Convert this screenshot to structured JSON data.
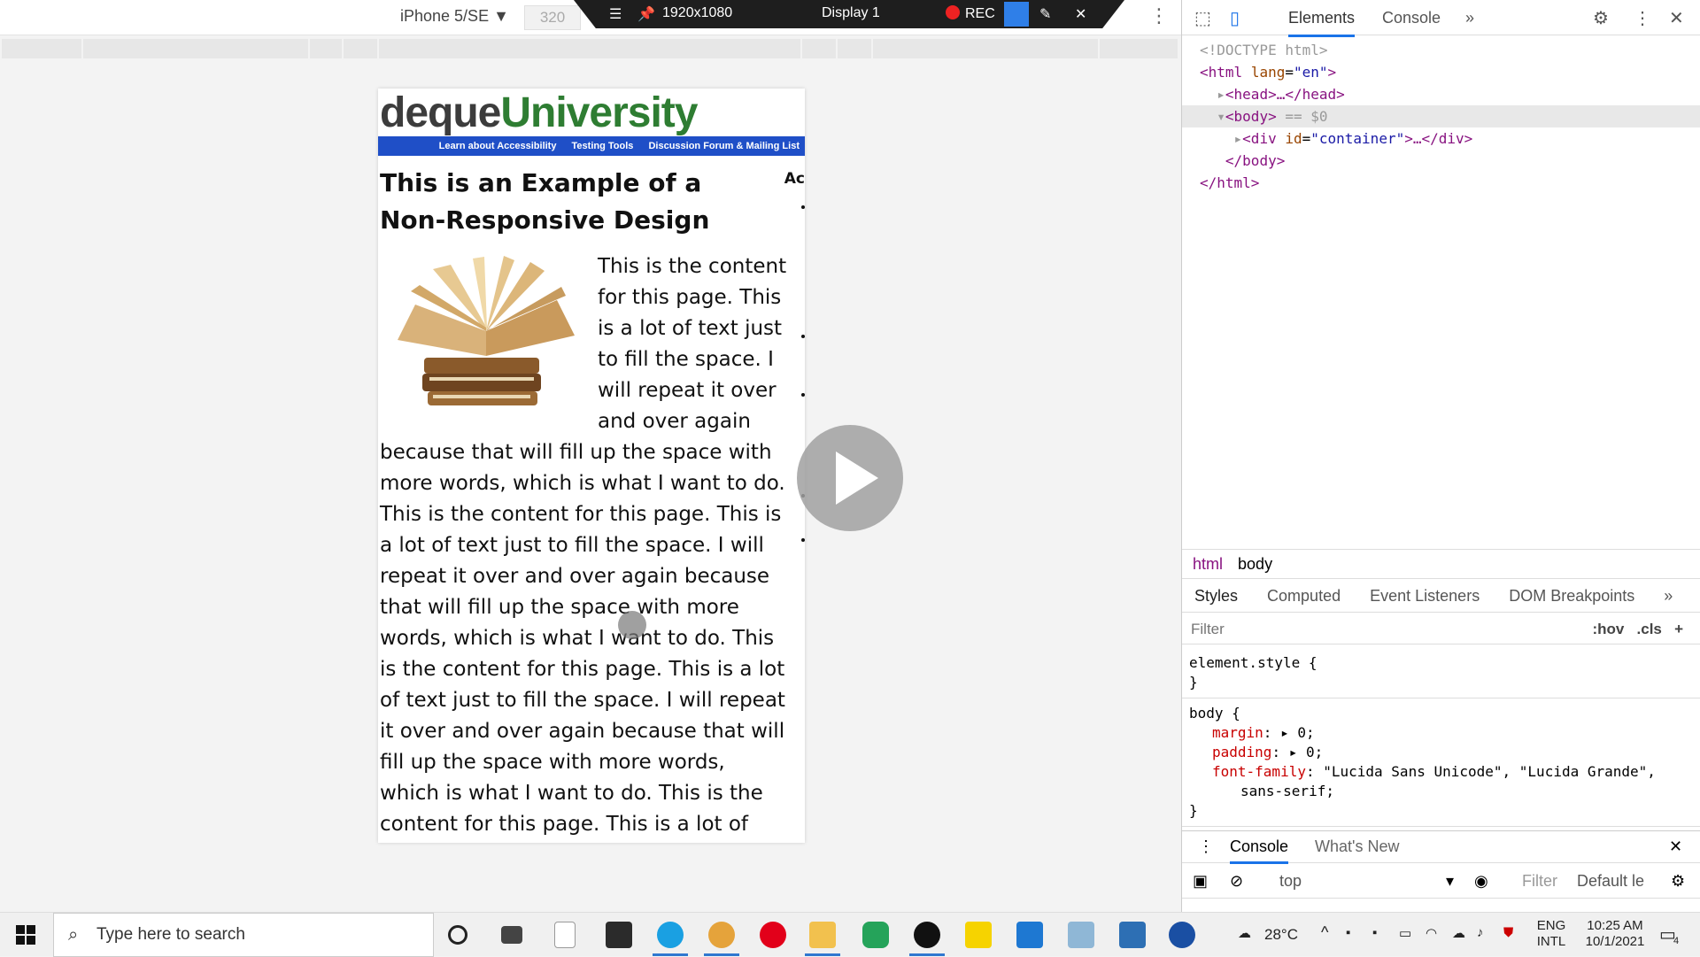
{
  "device_toolbar": {
    "device_name": "iPhone 5/SE ▼",
    "width_value": "320",
    "more_icon": "vertical-dots-icon"
  },
  "recorder": {
    "menu_icon": "hamburger-icon",
    "pin_icon": "pin-icon",
    "resolution": "1920x1080",
    "display": "Display 1",
    "rec_label": "REC",
    "camera_icon": "camera-icon",
    "pen_icon": "pen-icon",
    "close_icon": "close-icon"
  },
  "page": {
    "logo_deque": "deque",
    "logo_university": "University",
    "nav": [
      "Learn about Accessibility",
      "Testing Tools",
      "Discussion Forum & Mailing List"
    ],
    "heading": "This is an Example of a Non-Responsive Design",
    "side_label": "Ac",
    "body_text": "This is the content for this page. This is a lot of text just to fill the space. I will repeat it over and over again because that will fill up the space with more words, which is what I want to do. This is the content for this page. This is a lot of text just to fill the space. I will repeat it over and over again because that will fill up the space with more words, which is what I want to do. This is the content for this page. This is a lot of text just to fill the space. I will repeat it over and over again because that will fill up the space with more words, which is what I want to do. This is the content for this page. This is a lot of text just to"
  },
  "devtools": {
    "tabs": [
      "Elements",
      "Console",
      "»"
    ],
    "dom": {
      "doctype": "<!DOCTYPE html>",
      "html_open_tag": "<html",
      "html_attr": "lang",
      "html_attr_val": "\"en\"",
      "head": "<head>…</head>",
      "body_open": "<body>",
      "body_marker": "== $0",
      "div_open": "<div",
      "div_attr": "id",
      "div_attr_val": "\"container\"",
      "div_rest": ">…</div>",
      "body_close": "</body>",
      "html_close": "</html>"
    },
    "breadcrumbs": [
      "html",
      "body"
    ],
    "style_tabs": [
      "Styles",
      "Computed",
      "Event Listeners",
      "DOM Breakpoints",
      "»"
    ],
    "filter_placeholder": "Filter",
    "filter_hov": ":hov",
    "filter_cls": ".cls",
    "filter_add": "+",
    "element_style_selector": "element.style {",
    "close_brace": "}",
    "body_selector": "body {",
    "props": [
      {
        "name": "margin",
        "value": "▸ 0;"
      },
      {
        "name": "padding",
        "value": "▸ 0;"
      },
      {
        "name": "font-family",
        "value": "\"Lucida Sans Unicode\", \"Lucida Grande\","
      }
    ],
    "font_family_cont": "sans-serif;",
    "drawer_tabs": [
      "Console",
      "What's New"
    ],
    "drawer_context": "top",
    "drawer_filter": "Filter",
    "drawer_levels": "Default le"
  },
  "taskbar": {
    "search_placeholder": "Type here to search",
    "weather": "28°C",
    "lang_top": "ENG",
    "lang_bottom": "INTL",
    "time": "10:25 AM",
    "date": "10/1/2021",
    "notification_count": "4"
  }
}
